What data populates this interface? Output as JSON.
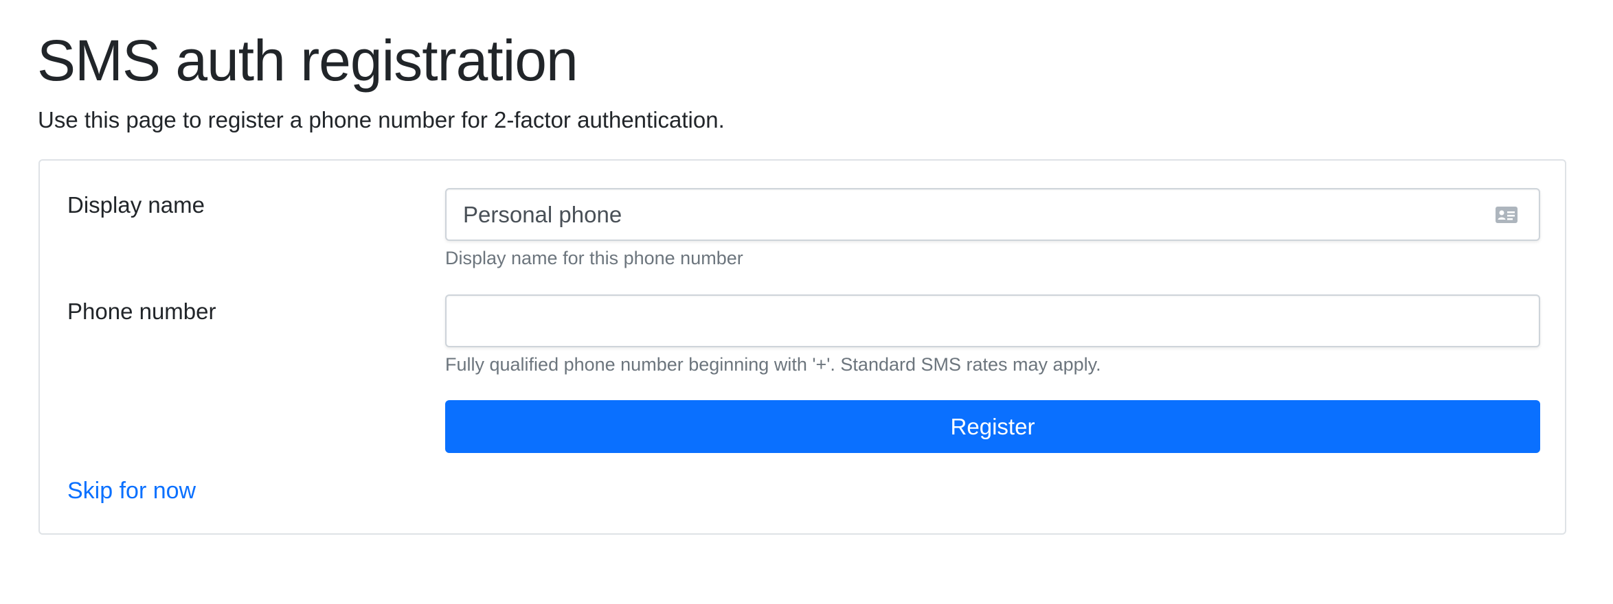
{
  "header": {
    "title": "SMS auth registration",
    "subtitle": "Use this page to register a phone number for 2-factor authentication."
  },
  "form": {
    "display_name": {
      "label": "Display name",
      "value": "Personal phone",
      "help": "Display name for this phone number",
      "icon": "contact-card-icon"
    },
    "phone_number": {
      "label": "Phone number",
      "value": "",
      "help": "Fully qualified phone number beginning with '+'. Standard SMS rates may apply."
    },
    "register_label": "Register",
    "skip_label": "Skip for now"
  },
  "colors": {
    "primary": "#0a70ff",
    "text": "#212529",
    "muted": "#6c757d",
    "border": "#dee2e6"
  }
}
